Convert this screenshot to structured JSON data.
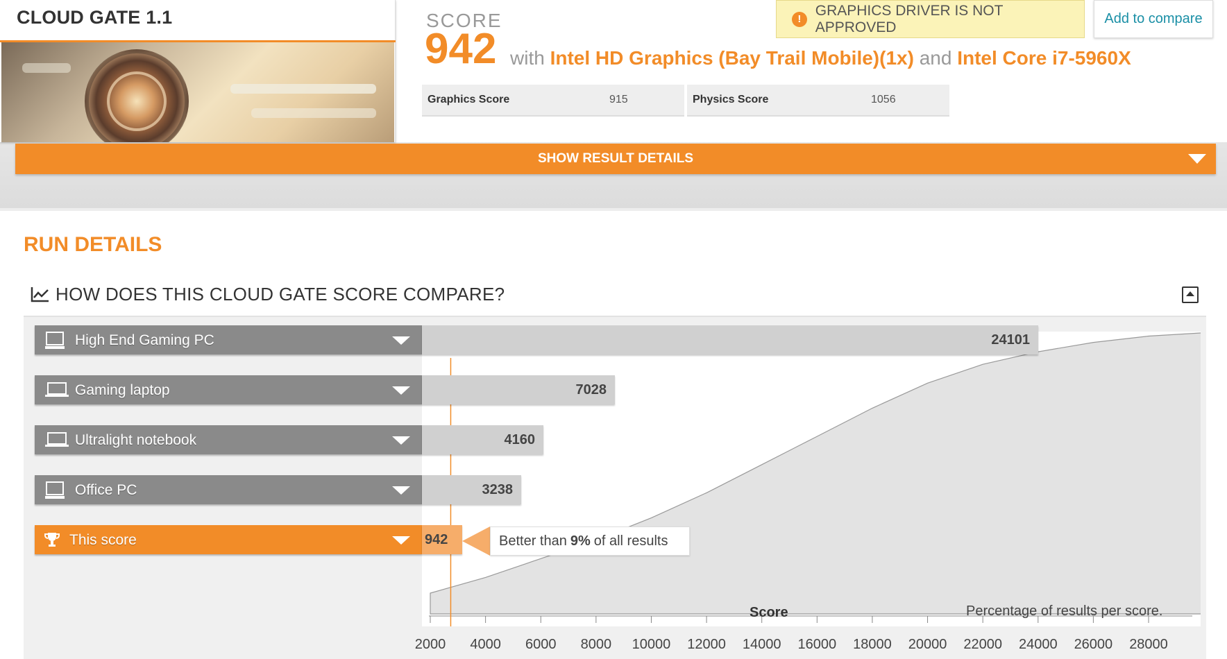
{
  "benchmark": {
    "title": "CLOUD GATE 1.1"
  },
  "score": {
    "label": "SCORE",
    "value": "942",
    "with_text": "with",
    "gpu": "Intel HD Graphics (Bay Trail Mobile)(1x)",
    "and_text": "and",
    "cpu": "Intel Core i7-5960X"
  },
  "warning": {
    "icon": "exclamation-icon",
    "text": "GRAPHICS DRIVER IS NOT APPROVED"
  },
  "add_compare": "Add to compare",
  "subscores": [
    {
      "name": "Graphics Score",
      "value": "915"
    },
    {
      "name": "Physics Score",
      "value": "1056"
    }
  ],
  "show_details": "SHOW RESULT DETAILS",
  "run_details": {
    "title": "RUN DETAILS",
    "compare_title": "HOW DOES THIS CLOUD GATE SCORE COMPARE?"
  },
  "colors": {
    "accent": "#f28c28",
    "accent_light": "#f6ad6a",
    "bar_gray": "#8a8a8a",
    "link": "#1a8fa6"
  },
  "chart_data": {
    "type": "bar",
    "categories": [
      "High End Gaming PC",
      "Gaming laptop",
      "Ultralight notebook",
      "Office PC",
      "This score"
    ],
    "icons": [
      "desktop-icon",
      "laptop-icon",
      "laptop-icon",
      "desktop-icon",
      "trophy-icon"
    ],
    "values": [
      24101,
      7028,
      4160,
      3238,
      942
    ],
    "highlight": "This score",
    "callout": {
      "prefix": "Better than",
      "value": "9%",
      "suffix": "of all results"
    },
    "xlabel": "Score",
    "distribution_label": "Percentage of results per score.",
    "x_ticks": [
      2000,
      4000,
      6000,
      8000,
      10000,
      12000,
      14000,
      16000,
      18000,
      20000,
      22000,
      24000,
      26000,
      28000
    ],
    "xlim": [
      1750,
      30000
    ],
    "distribution": {
      "x": [
        2000,
        4000,
        6000,
        8000,
        10000,
        12000,
        14000,
        16000,
        18000,
        20000,
        22000,
        24000,
        26000,
        28000,
        29900
      ],
      "y": [
        0.0,
        0.05,
        0.11,
        0.17,
        0.24,
        0.32,
        0.41,
        0.5,
        0.59,
        0.67,
        0.73,
        0.77,
        0.8,
        0.82,
        0.83
      ]
    }
  }
}
